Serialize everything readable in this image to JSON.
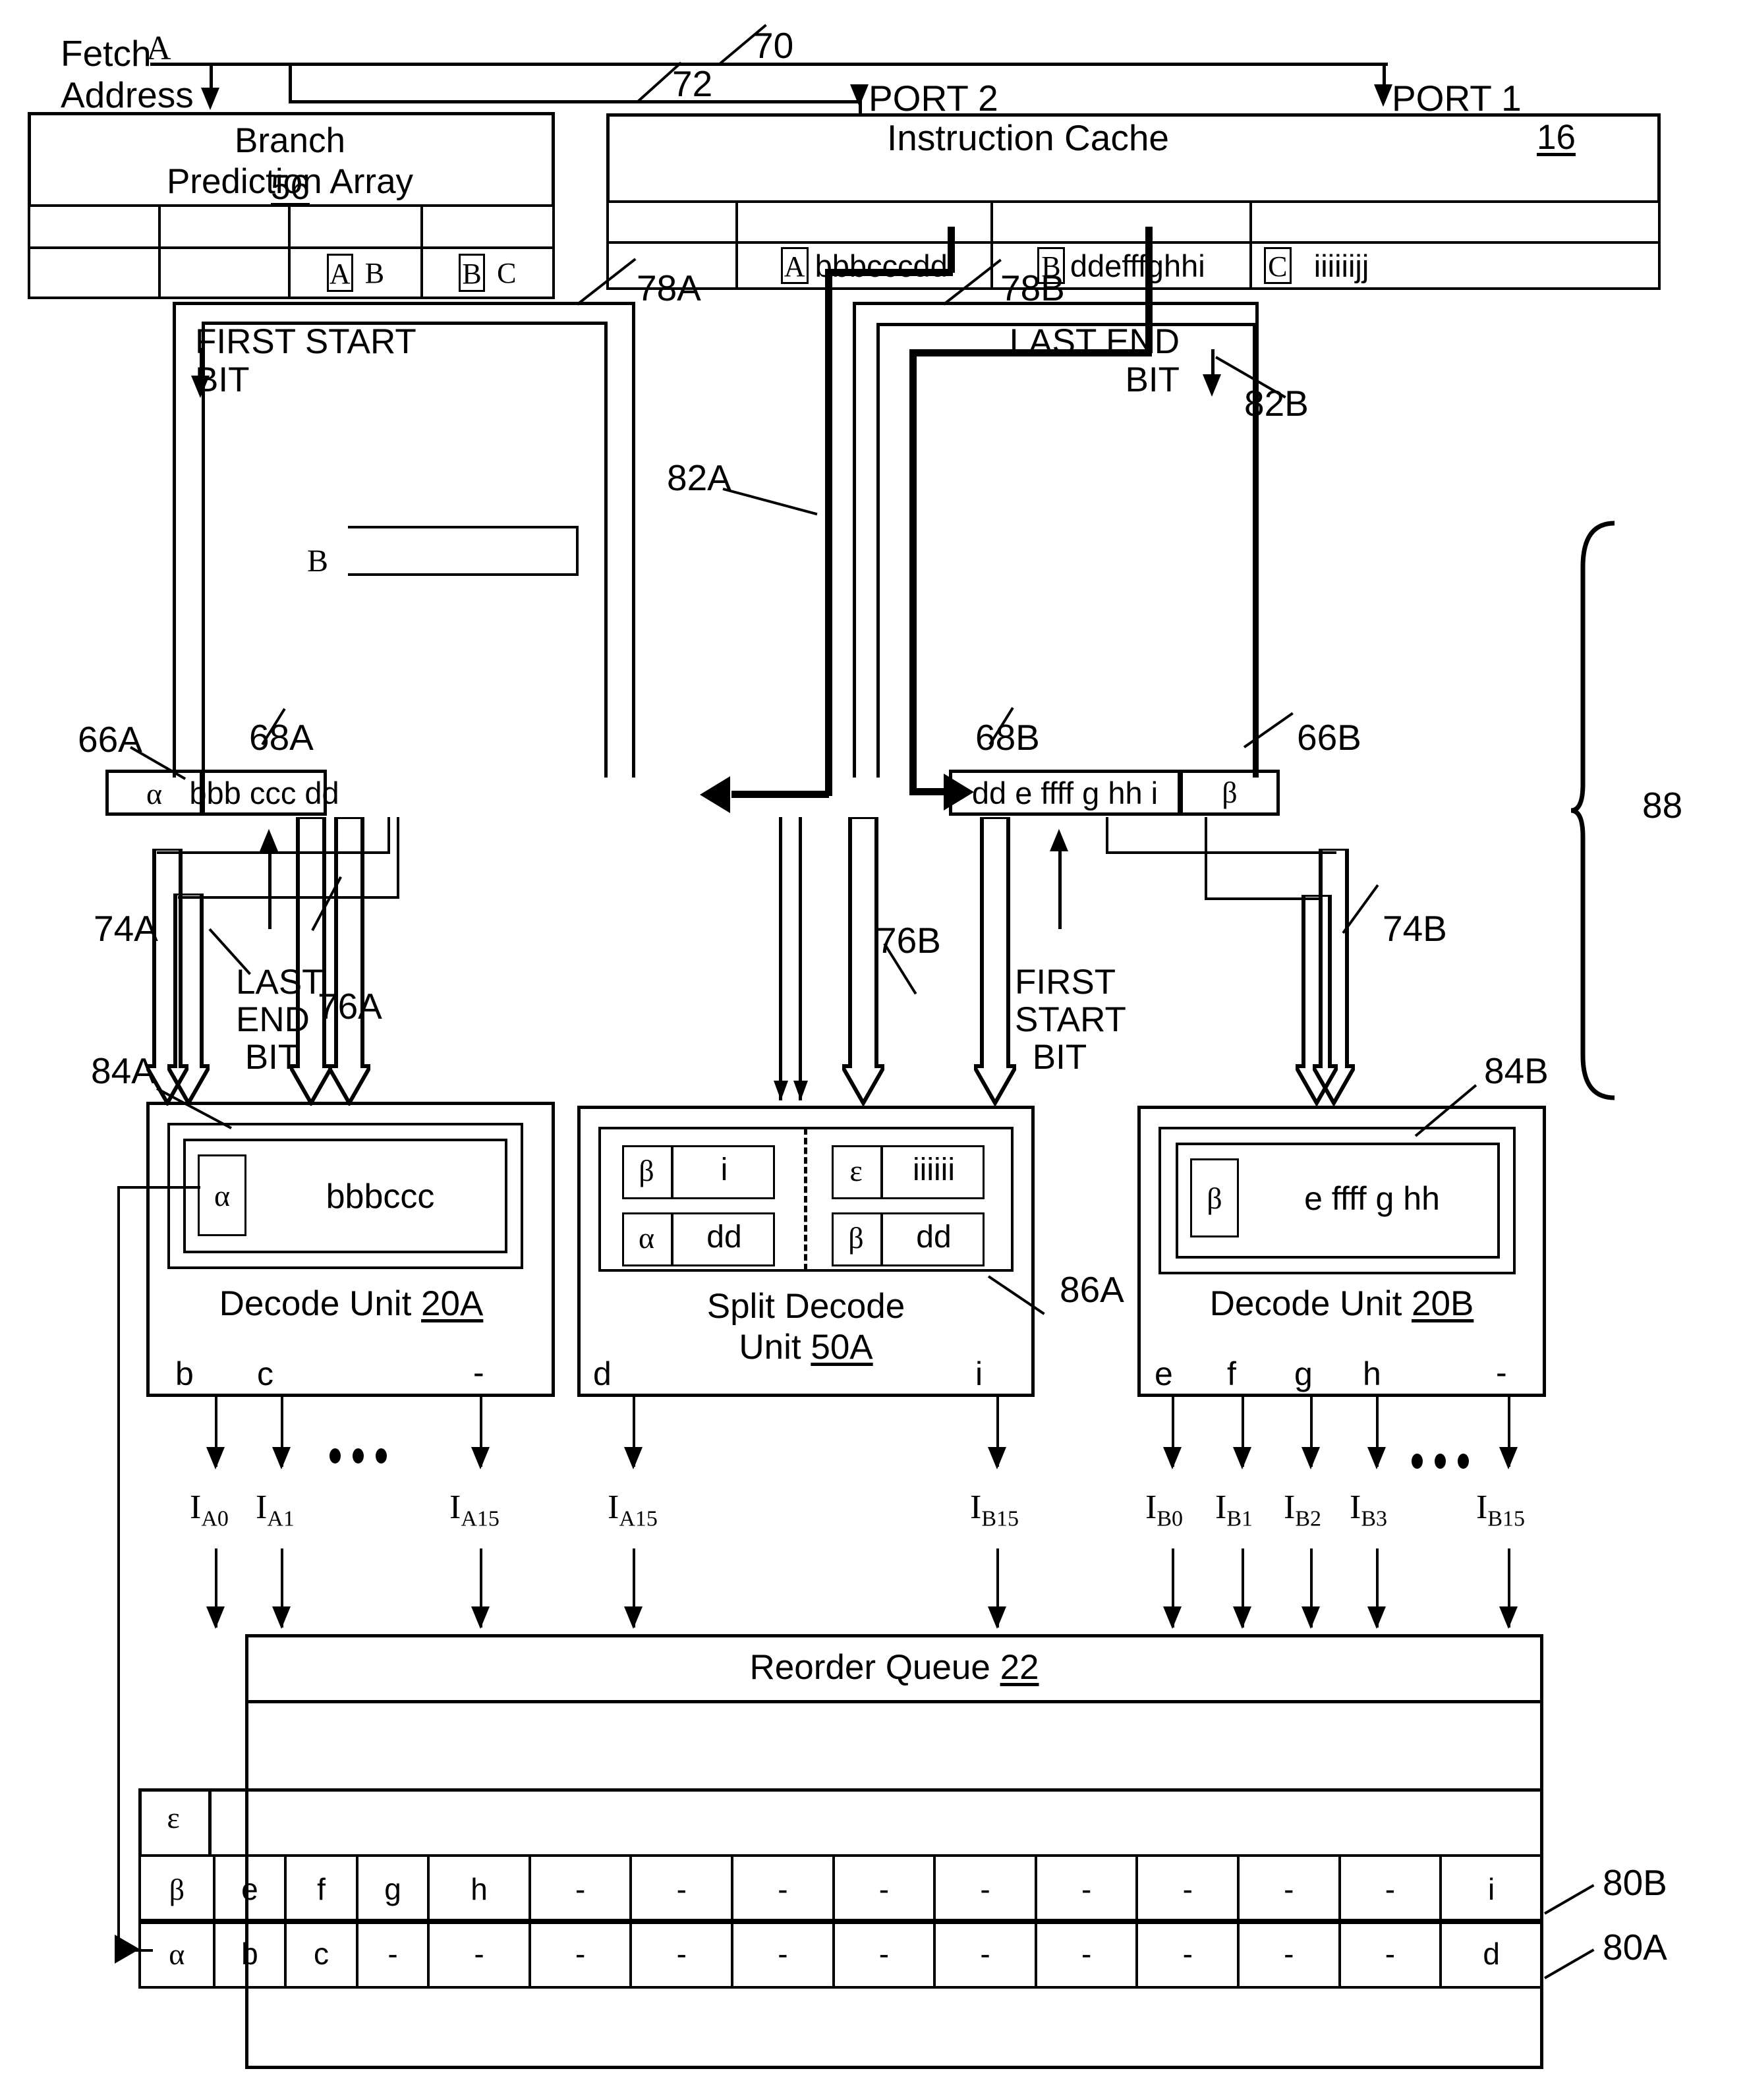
{
  "figure": {
    "labels": {
      "fetch_address": "Fetch\nAddress",
      "fetch_a": "A",
      "ref_70": "70",
      "ref_72": "72",
      "port2": "PORT 2",
      "port1": "PORT 1",
      "ref_82a": "82A",
      "ref_82b": "82B",
      "ref_78a": "78A",
      "ref_78b": "78B",
      "ref_66a": "66A",
      "ref_66b": "66B",
      "ref_68a": "68A",
      "ref_68b": "68B",
      "ref_74a": "74A",
      "ref_74b": "74B",
      "ref_76a": "76A",
      "ref_76b": "76B",
      "ref_84a": "84A",
      "ref_84b": "84B",
      "ref_86a": "86A",
      "ref_88": "88",
      "ref_80a": "80A",
      "ref_80b": "80B",
      "first_start_bit_left": "FIRST START\nBIT",
      "last_end_bit_right": "LAST END\nBIT",
      "last_end_bit_lower_left": "LAST\nEND\nBIT",
      "first_start_bit_lower_right": "FIRST\nSTART\nBIT",
      "branch_b_tag": "B"
    },
    "branch_prediction_array": {
      "title_line1": "Branch",
      "title_line2": "Prediction Array",
      "ref": "56",
      "row_cells": [
        "",
        "",
        "A B",
        "B C"
      ],
      "tagged_cells": [
        {
          "boxed": "A",
          "plain": "B"
        },
        {
          "boxed": "B",
          "plain": "C"
        }
      ]
    },
    "instruction_cache": {
      "title": "Instruction Cache",
      "ref": "16",
      "port_labels": [
        "PORT 2",
        "PORT 1"
      ],
      "data_row": [
        {
          "boxed": "A",
          "bytes": "bbbcccdd"
        },
        {
          "boxed": "B",
          "bytes": "ddefffghhi"
        },
        {
          "boxed": "C",
          "bytes": "iiiiiijj"
        }
      ]
    },
    "scan_bus_a": {
      "tag": "α",
      "bytes": "bbb  ccc  dd"
    },
    "scan_bus_b": {
      "bytes": "dd  e ffff g hh i",
      "tag": "β"
    },
    "decode_unit_a": {
      "name": "Decode Unit",
      "ref": "20A",
      "inner_tag": "α",
      "inner_bytes": "bbbccc",
      "outputs": [
        "b",
        "c",
        "-"
      ],
      "signal_labels": [
        "I",
        "I",
        "I"
      ],
      "signal_subs": [
        "A0",
        "A1",
        "A15"
      ]
    },
    "split_decode_unit": {
      "name_line1": "Split Decode",
      "name_line2": "Unit",
      "ref": "50A",
      "left_cells": [
        {
          "tag": "β",
          "val": "i"
        },
        {
          "tag": "α",
          "val": "dd"
        }
      ],
      "right_cells": [
        {
          "tag": "ε",
          "val": "iiiiii"
        },
        {
          "tag": "β",
          "val": "dd"
        }
      ],
      "outputs": [
        "d",
        "i"
      ],
      "signal_subs": [
        "A15",
        "B15"
      ]
    },
    "decode_unit_b": {
      "name": "Decode Unit",
      "ref": "20B",
      "inner_tag": "β",
      "inner_bytes": "e ffff g hh",
      "outputs": [
        "e",
        "f",
        "g",
        "h",
        "-"
      ],
      "signal_subs": [
        "B0",
        "B1",
        "B2",
        "B3",
        "B15"
      ]
    },
    "reorder_queue": {
      "title": "Reorder Queue",
      "ref": "22",
      "epsilon_tag": "ε",
      "rows": [
        {
          "tag": "β",
          "cells": [
            "e",
            "f",
            "g",
            "h",
            "-",
            "-",
            "-",
            "-",
            "-",
            "-",
            "-",
            "-",
            "-",
            "i"
          ],
          "ref": "80B"
        },
        {
          "tag": "α",
          "cells": [
            "b",
            "c",
            "-",
            "-",
            "-",
            "-",
            "-",
            "-",
            "-",
            "-",
            "-",
            "-",
            "-",
            "d"
          ],
          "ref": "80A"
        }
      ]
    }
  }
}
